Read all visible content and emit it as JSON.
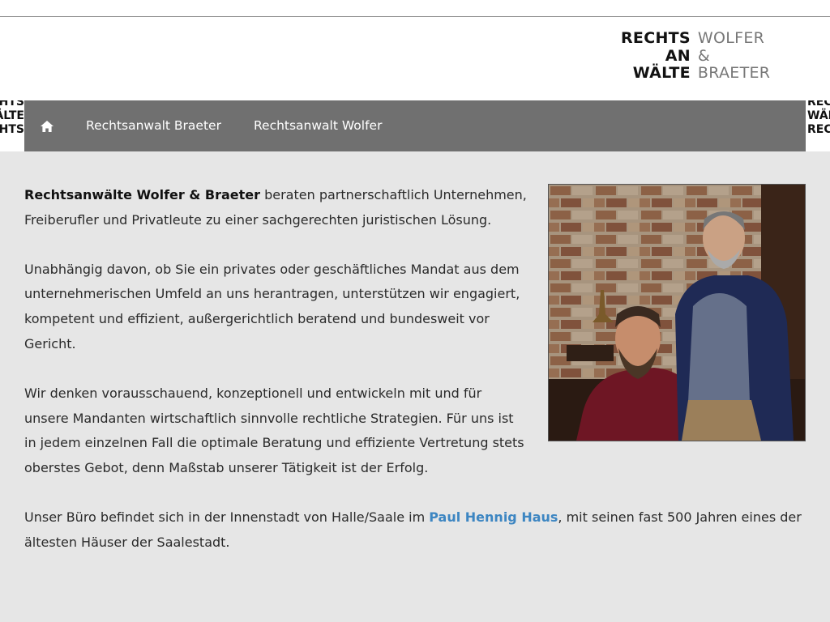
{
  "logo": {
    "left": [
      "RECHTS",
      "AN",
      "WÄLTE"
    ],
    "right": [
      "WOLFER",
      "&",
      "BRAETER"
    ]
  },
  "nav": {
    "home_icon": "home-icon",
    "items": [
      {
        "label": "Rechtsanwalt Braeter"
      },
      {
        "label": "Rechtsanwalt Wolfer"
      }
    ]
  },
  "intro": {
    "strong": "Rechtsanwälte Wolfer & Braeter",
    "rest": " beraten partnerschaftlich Unternehmen, Freiberufler und Privatleute zu einer sachgerechten juristischen Lösung."
  },
  "para2": "Unabhängig davon, ob Sie ein privates oder geschäftliches Mandat aus dem unternehmerischen Umfeld an uns herantragen, unterstützen wir engagiert, kompetent und effizient, außergerichtlich beratend und bundesweit vor Gericht.",
  "para3": "Wir denken vorausschauend, konzeptionell und entwickeln mit und für unsere Mandanten wirtschaftlich sinnvolle rechtliche Strategien. Für uns ist in jedem einzelnen Fall die optimale Beratung und effiziente Vertretung stets oberstes Gebot, denn Maßstab unserer Tätigkeit ist der Erfolg.",
  "para4": {
    "before": "Unser Büro befindet sich in der Innenstadt von Halle/Saale im ",
    "link": "Paul Hennig Haus",
    "after": ", mit seinen fast 500 Jahren eines der ältesten Häuser der Saalestadt."
  },
  "colors": {
    "nav_bg": "#707070",
    "page_bg": "#e6e6e6",
    "link": "#3d86c2"
  }
}
